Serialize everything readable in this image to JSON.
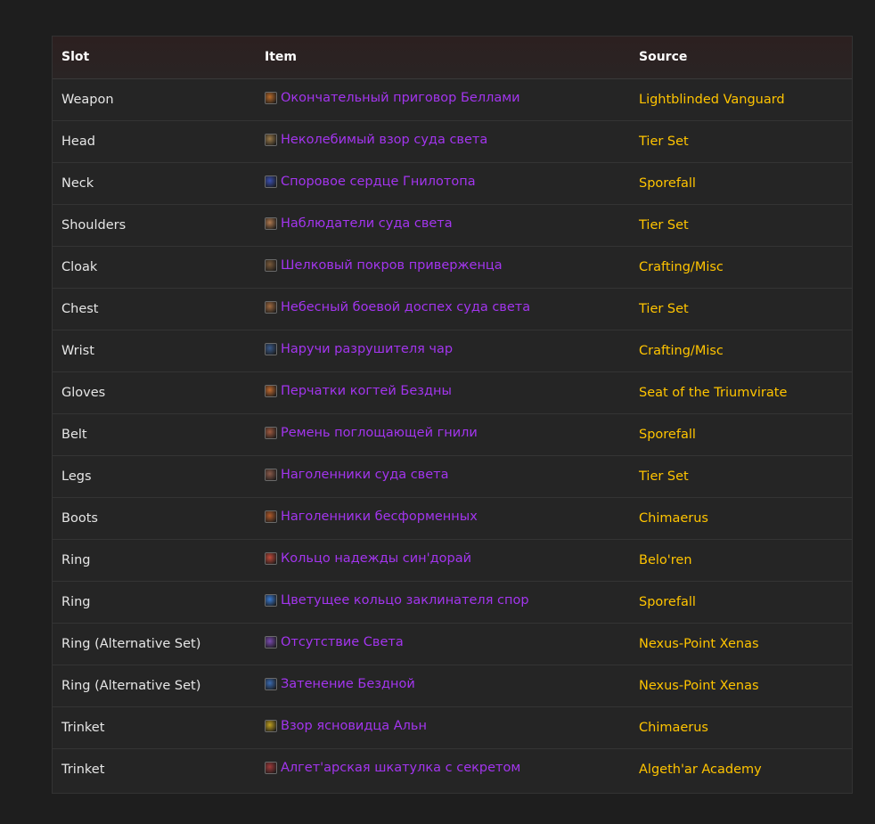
{
  "table": {
    "headers": {
      "slot": "Slot",
      "item": "Item",
      "source": "Source"
    },
    "rows": [
      {
        "slot": "Weapon",
        "item": "Окончательный приговор Беллами",
        "source": "Lightblinded Vanguard",
        "icon": "sword-icon",
        "icon_color": "#b86a2a"
      },
      {
        "slot": "Head",
        "item": "Неколебимый взор суда света",
        "source": "Tier Set",
        "icon": "helm-icon",
        "icon_color": "#9a7a4a"
      },
      {
        "slot": "Neck",
        "item": "Споровое сердце Гнилотопа",
        "source": "Sporefall",
        "icon": "amulet-icon",
        "icon_color": "#3a4fb0"
      },
      {
        "slot": "Shoulders",
        "item": "Наблюдатели суда света",
        "source": "Tier Set",
        "icon": "shoulders-icon",
        "icon_color": "#b07a50"
      },
      {
        "slot": "Cloak",
        "item": "Шелковый покров приверженца",
        "source": "Crafting/Misc",
        "icon": "cloak-icon",
        "icon_color": "#7a5a3a"
      },
      {
        "slot": "Chest",
        "item": "Небесный боевой доспех суда света",
        "source": "Tier Set",
        "icon": "chest-icon",
        "icon_color": "#a06a40"
      },
      {
        "slot": "Wrist",
        "item": "Наручи разрушителя чар",
        "source": "Crafting/Misc",
        "icon": "bracer-icon",
        "icon_color": "#3a5a8a"
      },
      {
        "slot": "Gloves",
        "item": "Перчатки когтей Бездны",
        "source": "Seat of the Triumvirate",
        "icon": "gloves-icon",
        "icon_color": "#c06a30"
      },
      {
        "slot": "Belt",
        "item": "Ремень поглощающей гнили",
        "source": "Sporefall",
        "icon": "belt-icon",
        "icon_color": "#a05a40"
      },
      {
        "slot": "Legs",
        "item": "Наголенники суда света",
        "source": "Tier Set",
        "icon": "legs-icon",
        "icon_color": "#8a5a4a"
      },
      {
        "slot": "Boots",
        "item": "Наголенники бесформенных",
        "source": "Chimaerus",
        "icon": "boots-icon",
        "icon_color": "#b05a2a"
      },
      {
        "slot": "Ring",
        "item": "Кольцо надежды син'дорай",
        "source": "Belo'ren",
        "icon": "ring-icon",
        "icon_color": "#c04a3a"
      },
      {
        "slot": "Ring",
        "item": "Цветущее кольцо заклинателя спор",
        "source": "Sporefall",
        "icon": "ring-icon",
        "icon_color": "#3a7ad0"
      },
      {
        "slot": "Ring (Alternative Set)",
        "item": "Отсутствие Света",
        "source": "Nexus-Point Xenas",
        "icon": "ring-icon",
        "icon_color": "#7a4ab0"
      },
      {
        "slot": "Ring (Alternative Set)",
        "item": "Затенение Бездной",
        "source": "Nexus-Point Xenas",
        "icon": "ring-icon",
        "icon_color": "#3a6ab0"
      },
      {
        "slot": "Trinket",
        "item": "Взор ясновидца Альн",
        "source": "Chimaerus",
        "icon": "trinket-icon",
        "icon_color": "#c0a020"
      },
      {
        "slot": "Trinket",
        "item": "Алгет'арская шкатулка с секретом",
        "source": "Algeth'ar Academy",
        "icon": "box-icon",
        "icon_color": "#a03a3a"
      }
    ]
  },
  "colors": {
    "item_epic": "#a335ee",
    "source_link": "#ffc400",
    "text": "#e6e6e6"
  }
}
